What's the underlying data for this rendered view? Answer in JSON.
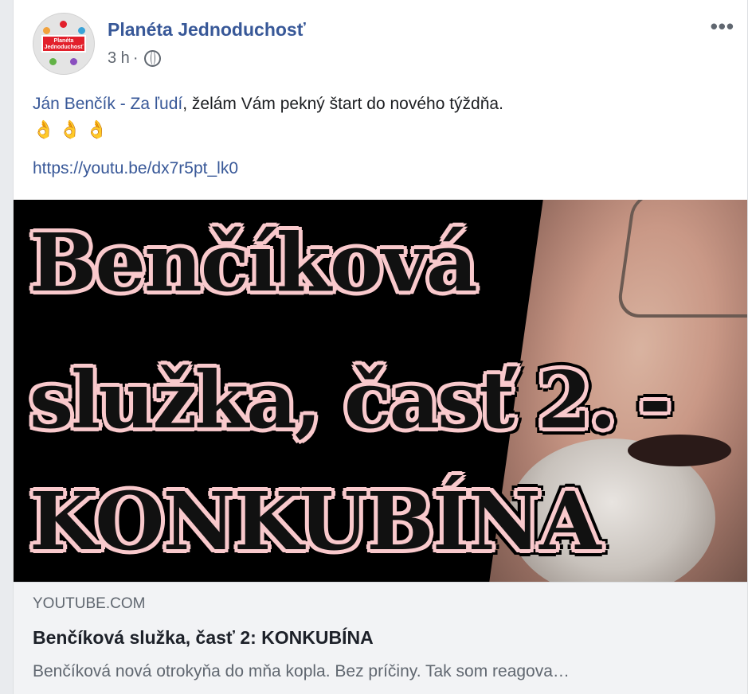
{
  "post": {
    "author": "Planéta Jednoduchosť",
    "time": "3 h",
    "separator": "·",
    "privacy_icon": "globe-icon",
    "more_icon": "more-options-icon",
    "more_label": "•••",
    "avatar": {
      "logo_line1": "Planéta",
      "logo_line2": "Jednoduchosť"
    },
    "text": {
      "mention": "Ján Benčík - Za ľudí",
      "rest": ", želám Vám pekný štart do nového týždňa.",
      "emoji": "👌👌👌"
    },
    "link": "https://youtu.be/dx7r5pt_lk0"
  },
  "preview": {
    "thumbnail_lines": [
      "Benčíková",
      "služka, časť 2. -",
      "KONKUBÍNA"
    ],
    "colors": {
      "outline": "#f9c9cc",
      "background": "#000000",
      "text": "#111111"
    }
  },
  "card": {
    "domain": "YOUTUBE.COM",
    "title": "Benčíková služka, časť 2: KONKUBÍNA",
    "description": "Benčíková nová otrokyňa do mňa kopla. Bez príčiny. Tak som reagova…"
  },
  "colors": {
    "link_blue": "#385898",
    "meta_gray": "#606770",
    "card_bg": "#f2f3f5"
  }
}
